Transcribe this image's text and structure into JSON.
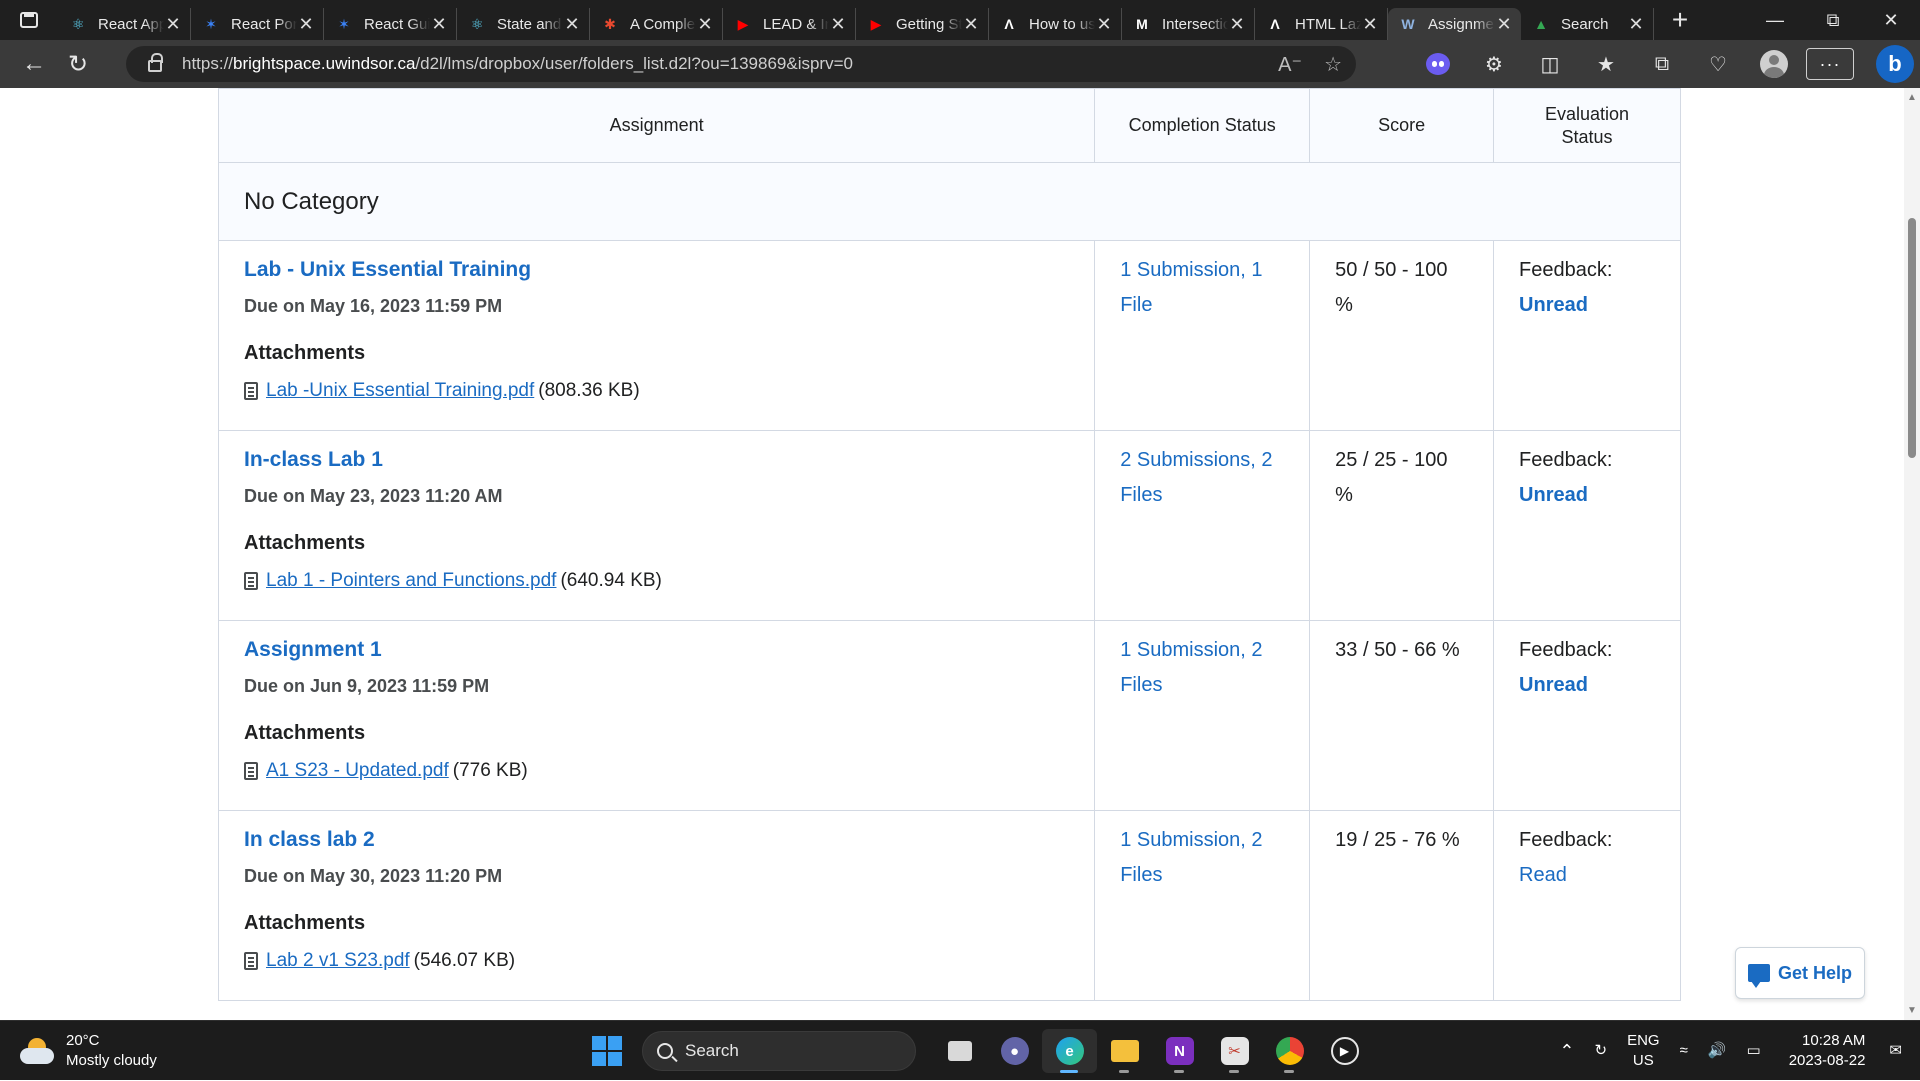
{
  "browser": {
    "tabs": [
      {
        "title": "React App",
        "favicon": "react-icon",
        "color": "#61dafb",
        "active": false
      },
      {
        "title": "React Portfolio",
        "favicon": "code-icon",
        "color": "#3b82f6",
        "active": false
      },
      {
        "title": "React Guide",
        "favicon": "code-icon",
        "color": "#3b82f6",
        "active": false
      },
      {
        "title": "State and Lifecycle",
        "favicon": "react-icon",
        "color": "#61dafb",
        "active": false
      },
      {
        "title": "A Complete Guide",
        "favicon": "asterisk-icon",
        "color": "#e8492f",
        "active": false
      },
      {
        "title": "LEAD & Inspire",
        "favicon": "youtube-icon",
        "color": "#ff0000",
        "active": false
      },
      {
        "title": "Getting Started",
        "favicon": "youtube-icon",
        "color": "#ff0000",
        "active": false
      },
      {
        "title": "How to use",
        "favicon": "lambda-icon",
        "color": "#ffffff",
        "active": false
      },
      {
        "title": "Intersection Observer",
        "favicon": "mdn-icon",
        "color": "#ffffff",
        "active": false
      },
      {
        "title": "HTML Lazy",
        "favicon": "lambda-icon",
        "color": "#ffffff",
        "active": false
      },
      {
        "title": "Assignments",
        "favicon": "w-icon",
        "color": "#8fb3e0",
        "active": true
      },
      {
        "title": "Search",
        "favicon": "drive-icon",
        "color": "#34a853",
        "active": false
      }
    ],
    "url_prefix": "https://",
    "url_host": "brightspace.uwindsor.ca",
    "url_path": "/d2l/lms/dropbox/user/folders_list.d2l?ou=139869&isprv=0"
  },
  "table": {
    "headers": {
      "assignment": "Assignment",
      "completion": "Completion Status",
      "score": "Score",
      "evaluation": "Evaluation Status"
    },
    "category": "No Category",
    "rows": [
      {
        "title": "Lab - Unix Essential Training",
        "due": "Due on May 16, 2023 11:59 PM",
        "attachments_label": "Attachments",
        "file": "Lab -Unix Essential Training.pdf",
        "size": "(808.36 KB)",
        "completion_1": "1 Submission, 1",
        "completion_2": "File",
        "score_1": "50 / 50 - 100",
        "score_2": "%",
        "feedback_label": "Feedback:",
        "feedback_status": "Unread"
      },
      {
        "title": "In-class Lab 1",
        "due": "Due on May 23, 2023 11:20 AM",
        "attachments_label": "Attachments",
        "file": "Lab 1 - Pointers and Functions.pdf",
        "size": "(640.94 KB)",
        "completion_1": "2 Submissions, 2",
        "completion_2": "Files",
        "score_1": "25 / 25 - 100",
        "score_2": "%",
        "feedback_label": "Feedback:",
        "feedback_status": "Unread"
      },
      {
        "title": "Assignment 1",
        "due": "Due on Jun 9, 2023 11:59 PM",
        "attachments_label": "Attachments",
        "file": "A1 S23 - Updated.pdf",
        "size": "(776 KB)",
        "completion_1": "1 Submission, 2",
        "completion_2": "Files",
        "score_1": "33 / 50 - 66 %",
        "score_2": "",
        "feedback_label": "Feedback:",
        "feedback_status": "Unread"
      },
      {
        "title": "In class lab 2",
        "due": "Due on May 30, 2023 11:20 PM",
        "attachments_label": "Attachments",
        "file": "Lab 2 v1 S23.pdf",
        "size": "(546.07 KB)",
        "completion_1": "1 Submission, 2",
        "completion_2": "Files",
        "score_1": "19 / 25 - 76 %",
        "score_2": "",
        "feedback_label": "Feedback:",
        "feedback_status": "Read"
      }
    ]
  },
  "help_button": "Get Help",
  "taskbar": {
    "temp": "20°C",
    "weather": "Mostly cloudy",
    "search": "Search",
    "lang_1": "ENG",
    "lang_2": "US",
    "time": "10:28 AM",
    "date": "2023-08-22"
  }
}
